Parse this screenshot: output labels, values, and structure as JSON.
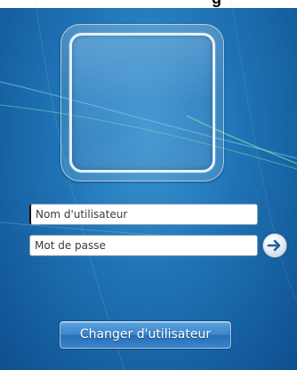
{
  "login": {
    "username_placeholder": "Nom d'utilisateur",
    "password_placeholder": "Mot de passe",
    "switch_user_label": "Changer d'utilisateur"
  },
  "icons": {
    "submit": "arrow-right-icon",
    "avatar": "user-picture-frame"
  },
  "colors": {
    "background": "#1f73b5",
    "button": "#3c86cb",
    "field_border": "#8aa0b8"
  }
}
